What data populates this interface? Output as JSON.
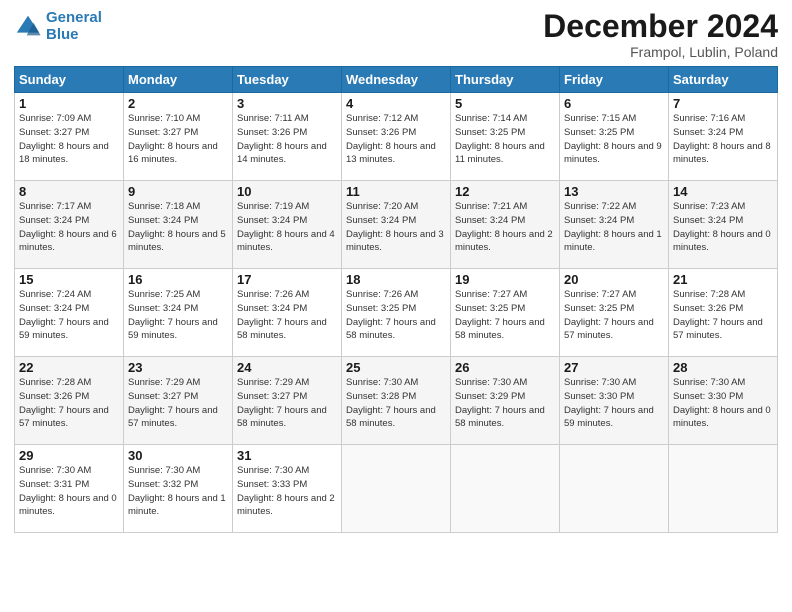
{
  "logo": {
    "line1": "General",
    "line2": "Blue"
  },
  "title": "December 2024",
  "location": "Frampol, Lublin, Poland",
  "days_of_week": [
    "Sunday",
    "Monday",
    "Tuesday",
    "Wednesday",
    "Thursday",
    "Friday",
    "Saturday"
  ],
  "weeks": [
    [
      {
        "day": 1,
        "sunrise": "7:09 AM",
        "sunset": "3:27 PM",
        "daylight": "8 hours and 18 minutes."
      },
      {
        "day": 2,
        "sunrise": "7:10 AM",
        "sunset": "3:27 PM",
        "daylight": "8 hours and 16 minutes."
      },
      {
        "day": 3,
        "sunrise": "7:11 AM",
        "sunset": "3:26 PM",
        "daylight": "8 hours and 14 minutes."
      },
      {
        "day": 4,
        "sunrise": "7:12 AM",
        "sunset": "3:26 PM",
        "daylight": "8 hours and 13 minutes."
      },
      {
        "day": 5,
        "sunrise": "7:14 AM",
        "sunset": "3:25 PM",
        "daylight": "8 hours and 11 minutes."
      },
      {
        "day": 6,
        "sunrise": "7:15 AM",
        "sunset": "3:25 PM",
        "daylight": "8 hours and 9 minutes."
      },
      {
        "day": 7,
        "sunrise": "7:16 AM",
        "sunset": "3:24 PM",
        "daylight": "8 hours and 8 minutes."
      }
    ],
    [
      {
        "day": 8,
        "sunrise": "7:17 AM",
        "sunset": "3:24 PM",
        "daylight": "8 hours and 6 minutes."
      },
      {
        "day": 9,
        "sunrise": "7:18 AM",
        "sunset": "3:24 PM",
        "daylight": "8 hours and 5 minutes."
      },
      {
        "day": 10,
        "sunrise": "7:19 AM",
        "sunset": "3:24 PM",
        "daylight": "8 hours and 4 minutes."
      },
      {
        "day": 11,
        "sunrise": "7:20 AM",
        "sunset": "3:24 PM",
        "daylight": "8 hours and 3 minutes."
      },
      {
        "day": 12,
        "sunrise": "7:21 AM",
        "sunset": "3:24 PM",
        "daylight": "8 hours and 2 minutes."
      },
      {
        "day": 13,
        "sunrise": "7:22 AM",
        "sunset": "3:24 PM",
        "daylight": "8 hours and 1 minute."
      },
      {
        "day": 14,
        "sunrise": "7:23 AM",
        "sunset": "3:24 PM",
        "daylight": "8 hours and 0 minutes."
      }
    ],
    [
      {
        "day": 15,
        "sunrise": "7:24 AM",
        "sunset": "3:24 PM",
        "daylight": "7 hours and 59 minutes."
      },
      {
        "day": 16,
        "sunrise": "7:25 AM",
        "sunset": "3:24 PM",
        "daylight": "7 hours and 59 minutes."
      },
      {
        "day": 17,
        "sunrise": "7:26 AM",
        "sunset": "3:24 PM",
        "daylight": "7 hours and 58 minutes."
      },
      {
        "day": 18,
        "sunrise": "7:26 AM",
        "sunset": "3:25 PM",
        "daylight": "7 hours and 58 minutes."
      },
      {
        "day": 19,
        "sunrise": "7:27 AM",
        "sunset": "3:25 PM",
        "daylight": "7 hours and 58 minutes."
      },
      {
        "day": 20,
        "sunrise": "7:27 AM",
        "sunset": "3:25 PM",
        "daylight": "7 hours and 57 minutes."
      },
      {
        "day": 21,
        "sunrise": "7:28 AM",
        "sunset": "3:26 PM",
        "daylight": "7 hours and 57 minutes."
      }
    ],
    [
      {
        "day": 22,
        "sunrise": "7:28 AM",
        "sunset": "3:26 PM",
        "daylight": "7 hours and 57 minutes."
      },
      {
        "day": 23,
        "sunrise": "7:29 AM",
        "sunset": "3:27 PM",
        "daylight": "7 hours and 57 minutes."
      },
      {
        "day": 24,
        "sunrise": "7:29 AM",
        "sunset": "3:27 PM",
        "daylight": "7 hours and 58 minutes."
      },
      {
        "day": 25,
        "sunrise": "7:30 AM",
        "sunset": "3:28 PM",
        "daylight": "7 hours and 58 minutes."
      },
      {
        "day": 26,
        "sunrise": "7:30 AM",
        "sunset": "3:29 PM",
        "daylight": "7 hours and 58 minutes."
      },
      {
        "day": 27,
        "sunrise": "7:30 AM",
        "sunset": "3:30 PM",
        "daylight": "7 hours and 59 minutes."
      },
      {
        "day": 28,
        "sunrise": "7:30 AM",
        "sunset": "3:30 PM",
        "daylight": "8 hours and 0 minutes."
      }
    ],
    [
      {
        "day": 29,
        "sunrise": "7:30 AM",
        "sunset": "3:31 PM",
        "daylight": "8 hours and 0 minutes."
      },
      {
        "day": 30,
        "sunrise": "7:30 AM",
        "sunset": "3:32 PM",
        "daylight": "8 hours and 1 minute."
      },
      {
        "day": 31,
        "sunrise": "7:30 AM",
        "sunset": "3:33 PM",
        "daylight": "8 hours and 2 minutes."
      },
      null,
      null,
      null,
      null
    ]
  ]
}
